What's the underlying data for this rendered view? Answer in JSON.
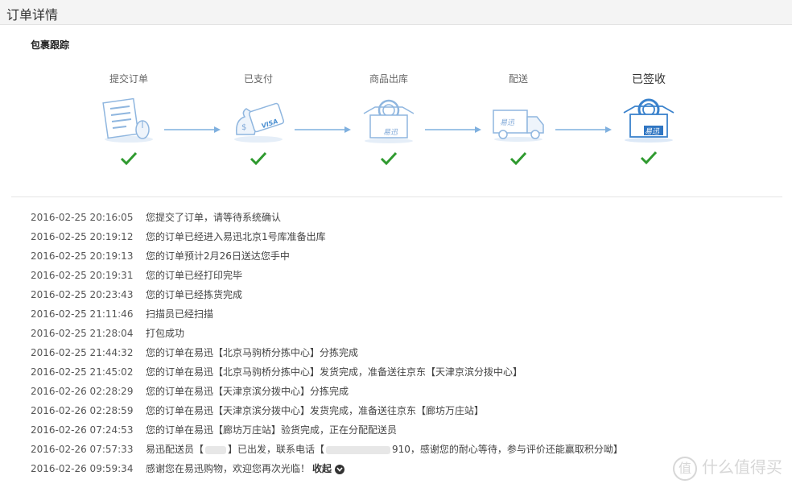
{
  "header": {
    "title": "订单详情"
  },
  "section": {
    "title": "包裹跟踪"
  },
  "steps": [
    {
      "label": "提交订单",
      "icon": "order-form-icon",
      "done": true
    },
    {
      "label": "已支付",
      "icon": "payment-icon",
      "done": true
    },
    {
      "label": "商品出库",
      "icon": "package-out-icon",
      "done": true
    },
    {
      "label": "配送",
      "icon": "delivery-truck-icon",
      "done": true
    },
    {
      "label": "已签收",
      "icon": "package-received-icon",
      "done": true
    }
  ],
  "brand": {
    "box_text": "易迅",
    "card_text": "VISA",
    "accent": "#4a8fd1",
    "check_color": "#2f9a2f"
  },
  "log": [
    {
      "time": "2016-02-25 20:16:05",
      "msg": "您提交了订单，请等待系统确认"
    },
    {
      "time": "2016-02-25 20:19:12",
      "msg": "您的订单已经进入易迅北京1号库准备出库"
    },
    {
      "time": "2016-02-25 20:19:13",
      "msg": "您的订单预计2月26日送达您手中"
    },
    {
      "time": "2016-02-25 20:19:31",
      "msg": "您的订单已经打印完毕"
    },
    {
      "time": "2016-02-25 20:23:43",
      "msg": "您的订单已经拣货完成"
    },
    {
      "time": "2016-02-25 21:11:46",
      "msg": "扫描员已经扫描"
    },
    {
      "time": "2016-02-25 21:28:04",
      "msg": "打包成功"
    },
    {
      "time": "2016-02-25 21:44:32",
      "msg": "您的订单在易迅【北京马驹桥分拣中心】分拣完成"
    },
    {
      "time": "2016-02-25 21:45:02",
      "msg": "您的订单在易迅【北京马驹桥分拣中心】发货完成，准备送往京东【天津京滨分拨中心】"
    },
    {
      "time": "2016-02-26 02:28:29",
      "msg": "您的订单在易迅【天津京滨分拨中心】分拣完成"
    },
    {
      "time": "2016-02-26 02:28:59",
      "msg": "您的订单在易迅【天津京滨分拨中心】发货完成，准备送往京东【廊坊万庄站】"
    },
    {
      "time": "2016-02-26 07:24:53",
      "msg": "您的订单在易迅【廊坊万庄站】验货完成，正在分配配送员"
    },
    {
      "time": "2016-02-26 07:57:33",
      "msg_parts": [
        "易迅配送员【",
        "】已出发，联系电话【",
        "910，感谢您的耐心等待，参与评价还能赢取积分呦】"
      ]
    },
    {
      "time": "2016-02-26 09:59:34",
      "msg": "感谢您在易迅购物，欢迎您再次光临！"
    }
  ],
  "collapse_label": "收起",
  "watermark": {
    "symbol": "值",
    "text": "什么值得买"
  }
}
